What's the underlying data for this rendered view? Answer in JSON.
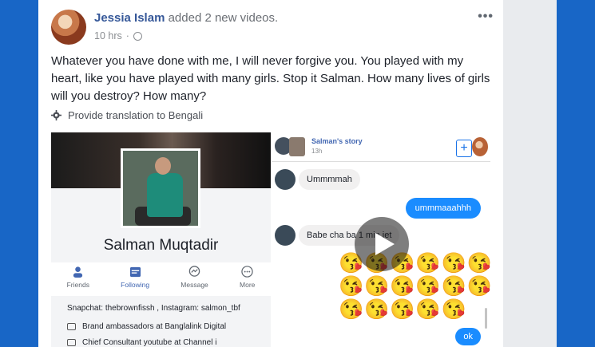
{
  "post": {
    "author": "Jessia Islam",
    "action": "added 2 new videos.",
    "time": "10 hrs",
    "separator": "·",
    "more_icon": "•••",
    "text": "Whatever you have done with me, I will never forgive you. You played with my heart, like you have played with many girls. Stop it Salman. How many lives of girls will you destroy? How many?",
    "translate_label": "Provide translation to Bengali"
  },
  "profile": {
    "name": "Salman Muqtadir",
    "actions": [
      {
        "label": "Friends",
        "icon": "friends-icon"
      },
      {
        "label": "Following",
        "icon": "following-icon"
      },
      {
        "label": "Message",
        "icon": "messenger-icon"
      },
      {
        "label": "More",
        "icon": "more-icon"
      }
    ],
    "bio": {
      "snapchat": "Snapchat: thebrownfissh , Instagram: salmon_tbf",
      "line1": "Brand ambassadors at Banglalink Digital",
      "line2": "Chief Consultant youtube at Channel i"
    }
  },
  "chat": {
    "story_title": "Salman's story",
    "story_time": "13h",
    "plus_icon": "+",
    "messages": [
      {
        "text": "Ummmmah"
      },
      {
        "text": "ummmaaahhh"
      },
      {
        "text": "Babe cha ba 1 min jet"
      },
      {
        "text": "ok"
      }
    ],
    "emoji_rows": [
      "😘😘😘😘😘😘",
      "😘😘😘😘😘😘",
      "😘😘😘😘😘"
    ]
  },
  "colors": {
    "page_bg": "#1a68c8",
    "link": "#365899",
    "messenger_blue": "#1a8cff"
  }
}
